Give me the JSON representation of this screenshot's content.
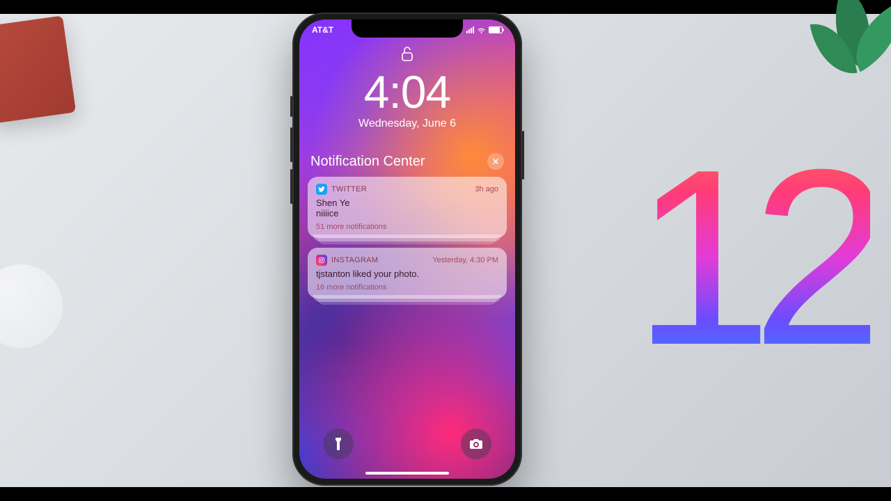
{
  "background": {
    "version_label": "12"
  },
  "status_bar": {
    "carrier": "AT&T"
  },
  "lock_screen": {
    "time": "4:04",
    "date": "Wednesday, June 6"
  },
  "notification_center": {
    "title": "Notification Center"
  },
  "notifications": [
    {
      "app_name": "TWITTER",
      "timestamp": "3h ago",
      "title": "Shen Ye",
      "body": "niiiice",
      "more": "51 more notifications",
      "icon": "twitter"
    },
    {
      "app_name": "INSTAGRAM",
      "timestamp": "Yesterday, 4:30 PM",
      "title": "",
      "body": "tjstanton liked your photo.",
      "more": "16 more notifications",
      "icon": "instagram"
    }
  ]
}
